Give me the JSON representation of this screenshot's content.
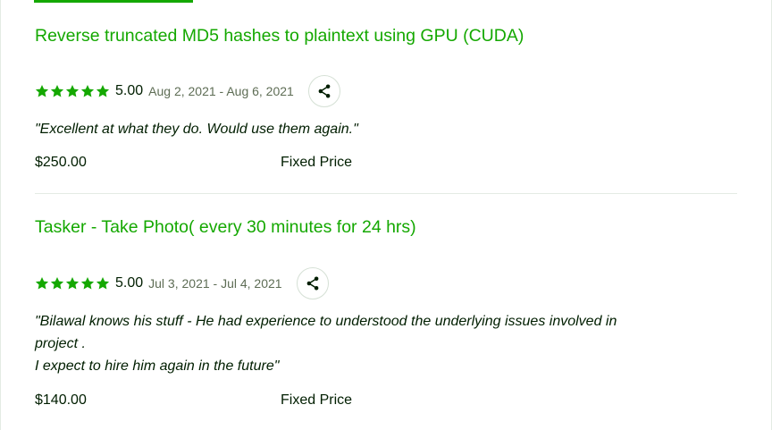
{
  "accent_color": "#14a800",
  "jobs": [
    {
      "title": "Reverse truncated MD5 hashes to plaintext using GPU (CUDA)",
      "stars": 5,
      "score": "5.00",
      "dates": "Aug 2, 2021 - Aug 6, 2021",
      "share_icon": "share-icon",
      "feedback_lines": [
        "\"Excellent at what they do. Would use them again.\""
      ],
      "price": "$250.00",
      "price_type": "Fixed Price"
    },
    {
      "title": "Tasker - Take Photo( every 30 minutes for 24 hrs)",
      "stars": 5,
      "score": "5.00",
      "dates": "Jul 3, 2021 - Jul 4, 2021",
      "share_icon": "share-icon",
      "feedback_lines": [
        "\"Bilawal knows his stuff - He had experience to understood the underlying issues involved in",
        "project .",
        "I expect to hire him again in the future\""
      ],
      "price": "$140.00",
      "price_type": "Fixed Price"
    }
  ]
}
